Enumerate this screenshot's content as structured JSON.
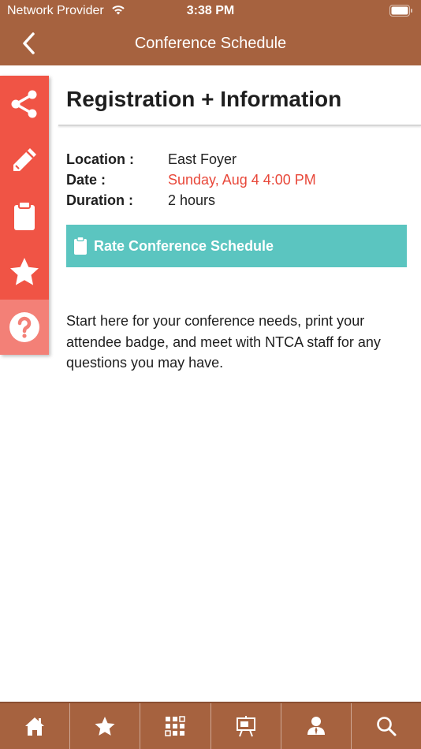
{
  "status_bar": {
    "carrier": "Network Provider",
    "time": "3:38 PM"
  },
  "nav": {
    "title": "Conference Schedule",
    "back_icon": "chevron-left-icon"
  },
  "side_actions": [
    {
      "name": "share",
      "icon": "share-icon"
    },
    {
      "name": "notes",
      "icon": "pencil-icon"
    },
    {
      "name": "survey",
      "icon": "clipboard-icon"
    },
    {
      "name": "favorite",
      "icon": "star-icon"
    },
    {
      "name": "help",
      "icon": "question-icon"
    }
  ],
  "session": {
    "title": "Registration + Information",
    "location_label": "Location :",
    "location_value": "East Foyer",
    "date_label": "Date :",
    "date_value": "Sunday, Aug 4 4:00 PM",
    "duration_label": "Duration :",
    "duration_value": "2 hours",
    "rate_button": "Rate Conference Schedule",
    "description": "Start here for your conference needs, print your attendee badge, and meet with NTCA staff for any questions you may have."
  },
  "tab_bar": [
    {
      "name": "home",
      "icon": "home-icon"
    },
    {
      "name": "favorites",
      "icon": "star-icon"
    },
    {
      "name": "qr",
      "icon": "qr-code-icon"
    },
    {
      "name": "presentations",
      "icon": "easel-icon"
    },
    {
      "name": "attendees",
      "icon": "person-icon"
    },
    {
      "name": "search",
      "icon": "search-icon"
    }
  ],
  "colors": {
    "header": "#A6623F",
    "rail": "#F05445",
    "rail_help": "#F38077",
    "rate_button": "#5BC5C0",
    "date_value": "#E8483A"
  }
}
